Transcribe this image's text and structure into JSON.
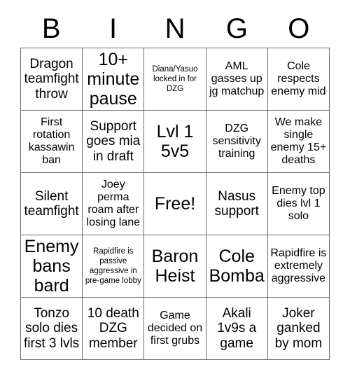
{
  "header": {
    "letters": [
      "B",
      "I",
      "N",
      "G",
      "O"
    ]
  },
  "grid": {
    "rows": 5,
    "columns": 5,
    "border_color": "#6b6b6b",
    "background_color": "#ffffff",
    "text_color": "#000000",
    "cells": [
      {
        "text": "Dragon teamfight throw",
        "size": "lg",
        "free": false
      },
      {
        "text": "10+ minute pause",
        "size": "xl",
        "free": false
      },
      {
        "text": "Diana/Yasuo locked in for DZG",
        "size": "sm",
        "free": false
      },
      {
        "text": "AML gasses up jg matchup",
        "size": "md",
        "free": false
      },
      {
        "text": "Cole respects enemy mid",
        "size": "md",
        "free": false
      },
      {
        "text": "First rotation kassawin ban",
        "size": "md",
        "free": false
      },
      {
        "text": "Support goes mia in draft",
        "size": "lg",
        "free": false
      },
      {
        "text": "Lvl 1 5v5",
        "size": "xl",
        "free": false
      },
      {
        "text": "DZG sensitivity training",
        "size": "md",
        "free": false
      },
      {
        "text": "We make single enemy 15+ deaths",
        "size": "md",
        "free": false
      },
      {
        "text": "Silent teamfight",
        "size": "lg",
        "free": false
      },
      {
        "text": "Joey perma roam after losing lane",
        "size": "md",
        "free": false
      },
      {
        "text": "Free!",
        "size": "xl",
        "free": true
      },
      {
        "text": "Nasus support",
        "size": "lg",
        "free": false
      },
      {
        "text": "Enemy top dies lvl 1 solo",
        "size": "md",
        "free": false
      },
      {
        "text": "Enemy bans bard",
        "size": "xl",
        "free": false
      },
      {
        "text": "Rapidfire is passive aggressive in pre-game lobby",
        "size": "sm",
        "free": false
      },
      {
        "text": "Baron Heist",
        "size": "xl",
        "free": false
      },
      {
        "text": "Cole Bomba",
        "size": "xl",
        "free": false
      },
      {
        "text": "Rapidfire is extremely aggressive",
        "size": "md",
        "free": false
      },
      {
        "text": "Tonzo solo dies first 3 lvls",
        "size": "lg",
        "free": false
      },
      {
        "text": "10 death DZG member",
        "size": "lg",
        "free": false
      },
      {
        "text": "Game decided on first grubs",
        "size": "md",
        "free": false
      },
      {
        "text": "Akali 1v9s a game",
        "size": "lg",
        "free": false
      },
      {
        "text": "Joker ganked by mom",
        "size": "lg",
        "free": false
      }
    ]
  }
}
